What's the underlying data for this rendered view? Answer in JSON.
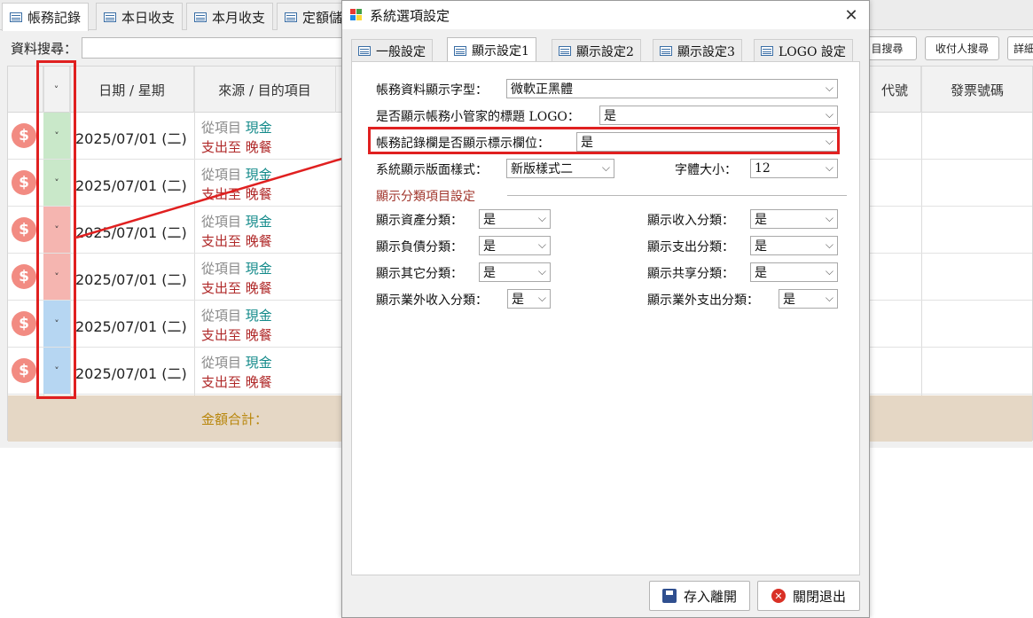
{
  "main_tabs": [
    {
      "label": "帳務記錄"
    },
    {
      "label": "本日收支"
    },
    {
      "label": "本月收支"
    },
    {
      "label": "定額儲"
    }
  ],
  "search": {
    "label": "資料搜尋："
  },
  "top_buttons": {
    "b1": "目搜尋",
    "b2": "收付人搜尋",
    "b3": "詳細"
  },
  "grid": {
    "headers": {
      "flag": "˅",
      "date": "日期 / 星期",
      "source": "來源 / 目的項目",
      "code": "代號",
      "invoice": "發票號碼"
    },
    "rows": [
      {
        "date": "2025/07/01 (二)",
        "from_prefix": "從項目",
        "from_item": "現金",
        "to_prefix": "支出至",
        "to_item": "晚餐",
        "flag": "˅"
      },
      {
        "date": "2025/07/01 (二)",
        "from_prefix": "從項目",
        "from_item": "現金",
        "to_prefix": "支出至",
        "to_item": "晚餐",
        "flag": "˅"
      },
      {
        "date": "2025/07/01 (二)",
        "from_prefix": "從項目",
        "from_item": "現金",
        "to_prefix": "支出至",
        "to_item": "晚餐",
        "flag": "˅"
      },
      {
        "date": "2025/07/01 (二)",
        "from_prefix": "從項目",
        "from_item": "現金",
        "to_prefix": "支出至",
        "to_item": "晚餐",
        "flag": "˅"
      },
      {
        "date": "2025/07/01 (二)",
        "from_prefix": "從項目",
        "from_item": "現金",
        "to_prefix": "支出至",
        "to_item": "晚餐",
        "flag": "˅"
      },
      {
        "date": "2025/07/01 (二)",
        "from_prefix": "從項目",
        "from_item": "現金",
        "to_prefix": "支出至",
        "to_item": "晚餐",
        "flag": "˅"
      }
    ],
    "coin_symbol": "$",
    "footer_label": "金額合計："
  },
  "dialog": {
    "title": "系統選項設定",
    "close": "✕",
    "tabs": [
      {
        "label": "一般設定"
      },
      {
        "label": "顯示設定1"
      },
      {
        "label": "顯示設定2"
      },
      {
        "label": "顯示設定3"
      },
      {
        "label": "LOGO 設定"
      }
    ],
    "fields": {
      "font_label": "帳務資料顯示字型：",
      "font_value": "微軟正黑體",
      "logo_label": "是否顯示帳務小管家的標題 LOGO：",
      "logo_value": "是",
      "flag_col_label": "帳務記錄欄是否顯示標示欄位：",
      "flag_col_value": "是",
      "layout_label": "系統顯示版面樣式：",
      "layout_value": "新版樣式二",
      "fontsize_label": "字體大小：",
      "fontsize_value": "12"
    },
    "section_title": "顯示分類項目設定",
    "categories": {
      "asset_label": "顯示資產分類：",
      "asset_value": "是",
      "income_label": "顯示收入分類：",
      "income_value": "是",
      "liability_label": "顯示負債分類：",
      "liability_value": "是",
      "expense_label": "顯示支出分類：",
      "expense_value": "是",
      "other_label": "顯示其它分類：",
      "other_value": "是",
      "shared_label": "顯示共享分類：",
      "shared_value": "是",
      "extra_income_label": "顯示業外收入分類：",
      "extra_income_value": "是",
      "extra_expense_label": "顯示業外支出分類：",
      "extra_expense_value": "是"
    },
    "save_button": "存入離開",
    "exit_button": "關閉退出",
    "dropdown_arrow": "⌵"
  },
  "colors": {
    "flag_green": "#c9e8c9",
    "flag_red": "#f5b5b0",
    "flag_blue": "#b6d6f2",
    "highlight": "#e02020"
  }
}
